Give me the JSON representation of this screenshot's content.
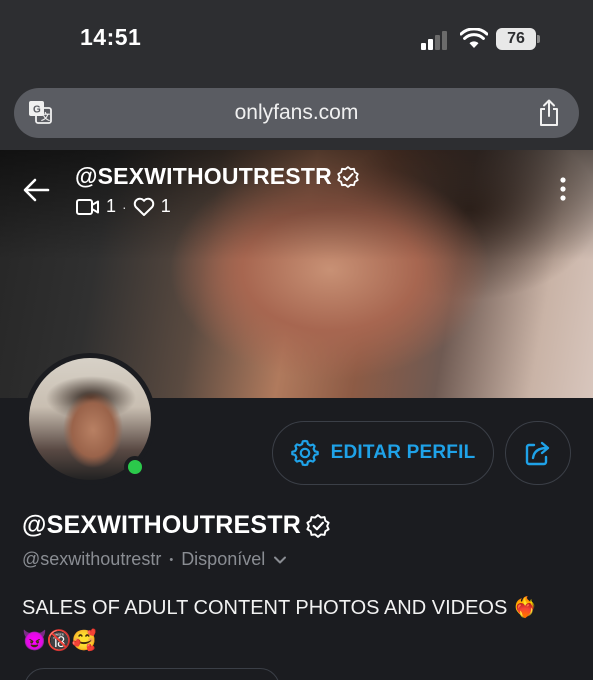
{
  "status_bar": {
    "time": "14:51",
    "battery": "76"
  },
  "browser": {
    "url": "onlyfans.com"
  },
  "cover": {
    "username": "@SEXWITHOUTRESTR",
    "videos_count": "1",
    "likes_count": "1"
  },
  "profile": {
    "display_name": "@SEXWITHOUTRESTR",
    "handle": "@sexwithoutrestr",
    "separator": "•",
    "availability": "Disponível",
    "bio_line1": "SALES OF ADULT CONTENT PHOTOS AND VIDEOS ❤️‍🔥",
    "bio_line2": "😈🔞🥰",
    "online_color": "#2bc94b"
  },
  "actions": {
    "edit_profile_label": "EDITAR PERFIL",
    "accent": "#1fa2e8"
  }
}
